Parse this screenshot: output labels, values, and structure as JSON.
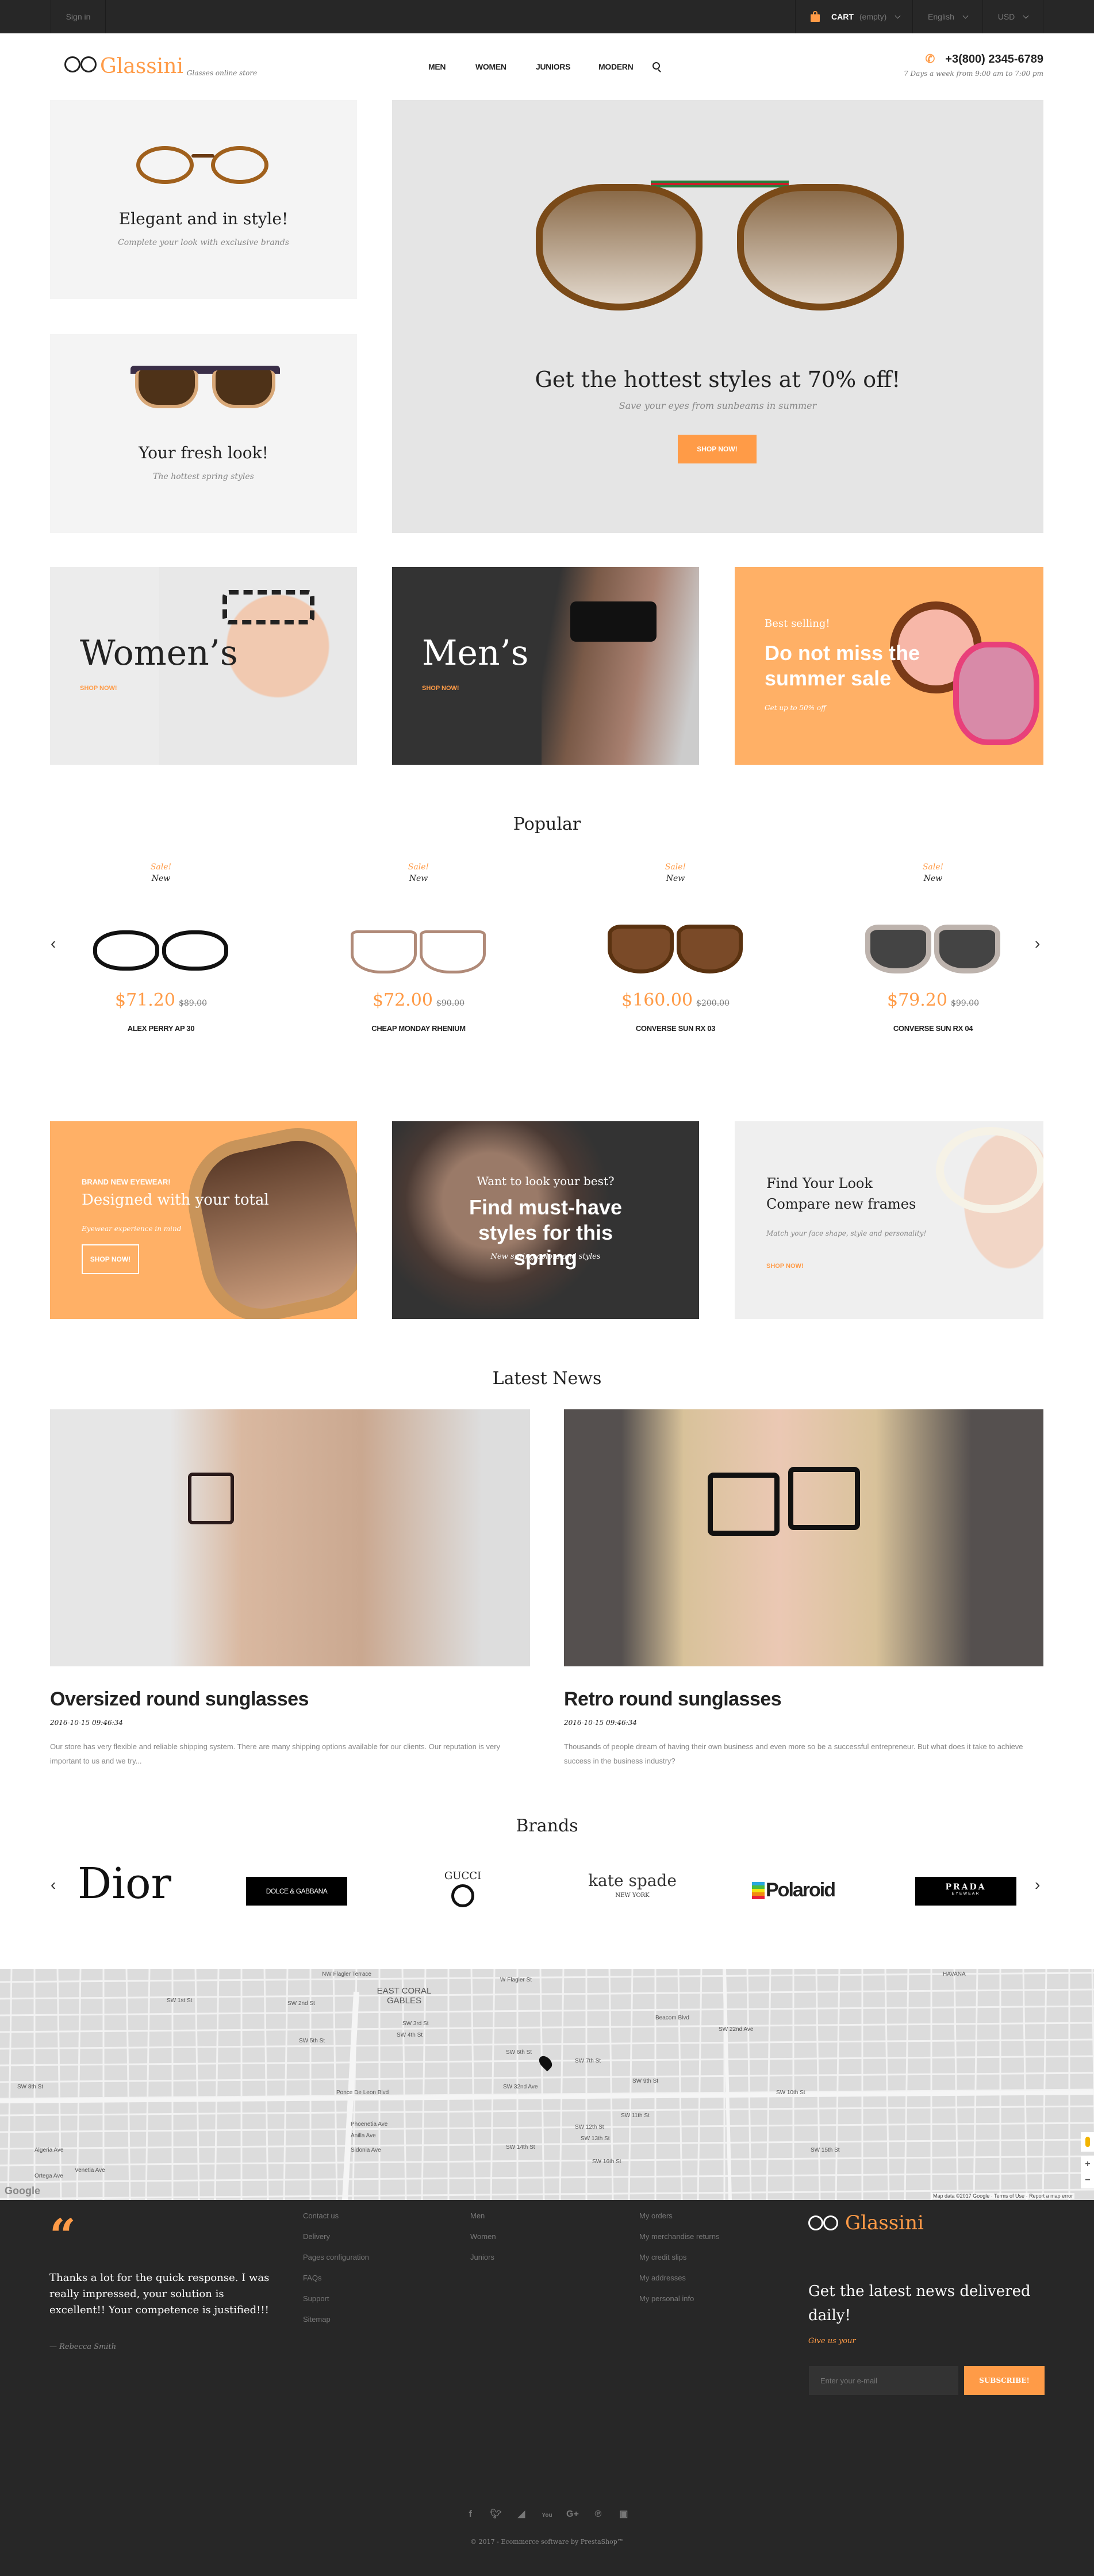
{
  "topbar": {
    "sign_in": "Sign in",
    "cart_label": "CART",
    "cart_status": "(empty)",
    "language": "English",
    "currency": "USD"
  },
  "header": {
    "logo_text": "Glassini",
    "tagline": "Glasses online store",
    "nav": [
      "MEN",
      "WOMEN",
      "JUNIORS",
      "MODERN"
    ],
    "phone": "+3(800) 2345-6789",
    "hours": "7 Days a week from 9:00 am to 7:00 pm"
  },
  "hero": {
    "left_top": {
      "title": "Elegant and in style!",
      "subtitle": "Complete your look with exclusive brands"
    },
    "left_bottom": {
      "title": "Your fresh look!",
      "subtitle": "The hottest spring styles"
    },
    "main": {
      "title": "Get the hottest styles at 70% off!",
      "subtitle": "Save your eyes from sunbeams in summer",
      "button": "SHOP NOW!"
    }
  },
  "categories": [
    {
      "title": "Women’s",
      "link": "SHOP NOW!"
    },
    {
      "title": "Men’s",
      "link": "SHOP NOW!"
    },
    {
      "kicker": "Best selling!",
      "title": "Do not miss the summer sale",
      "subtitle": "Get up to 50% off"
    }
  ],
  "popular": {
    "title": "Popular",
    "products": [
      {
        "sale": "Sale!",
        "badge": "New",
        "price": "$71.20",
        "old_price": "$89.00",
        "name": "ALEX PERRY AP 30"
      },
      {
        "sale": "Sale!",
        "badge": "New",
        "price": "$72.00",
        "old_price": "$90.00",
        "name": "CHEAP MONDAY RHENIUM"
      },
      {
        "sale": "Sale!",
        "badge": "New",
        "price": "$160.00",
        "old_price": "$200.00",
        "name": "CONVERSE SUN RX 03"
      },
      {
        "sale": "Sale!",
        "badge": "New",
        "price": "$79.20",
        "old_price": "$99.00",
        "name": "CONVERSE SUN RX 04"
      }
    ]
  },
  "promos": [
    {
      "kicker": "BRAND NEW EYEWEAR!",
      "title": "Designed with your total",
      "subtitle": "Eyewear experience in mind",
      "button": "SHOP NOW!"
    },
    {
      "kicker": "Want to look your best?",
      "title": "Find must-have styles for this spring",
      "subtitle": "New spring colors and styles"
    },
    {
      "title_line1": "Find Your Look",
      "title_line2": "Compare new frames",
      "subtitle": "Match your face shape, style and personality!",
      "link": "SHOP NOW!"
    }
  ],
  "news": {
    "title": "Latest News",
    "posts": [
      {
        "title": "Oversized round sunglasses",
        "date": "2016-10-15 09:46:34",
        "excerpt": "Our store has very flexible and reliable shipping system. There are many shipping options available for our clients. Our reputation is very important to us and we try..."
      },
      {
        "title": "Retro round sunglasses",
        "date": "2016-10-15 09:46:34",
        "excerpt": "Thousands of people dream of having their own business and even more so be a successful entrepreneur. But what does it take to achieve success in the business industry?"
      }
    ]
  },
  "brands": {
    "title": "Brands",
    "items": [
      "Dior",
      "DOLCE & GABBANA",
      "GUCCI",
      "kate spade",
      "Polaroid",
      "PRADA"
    ],
    "kate_sub": "NEW YORK",
    "prada_sub": "EYEWEAR"
  },
  "map": {
    "labels": [
      "EAST CORAL GABLES",
      "NW Flagler Terrace",
      "W Flagler St",
      "SW 1st St",
      "SW 2nd St",
      "SW 3rd St",
      "SW 4th St",
      "SW 5th St",
      "SW 6th St",
      "SW 7th St",
      "SW 8th St",
      "SW 9th St",
      "SW 10th St",
      "SW 11th St",
      "SW 12th St",
      "SW 13th St",
      "SW 14th St",
      "SW 15th St",
      "SW 16th St",
      "Ponce De Leon Blvd",
      "SW 32nd Ave",
      "SW 22nd Ave",
      "Beacom Blvd",
      "Phoenetia Ave",
      "Anilla Ave",
      "Sidonia Ave",
      "Algeria Ave",
      "Ortega Ave",
      "Venetia Ave",
      "HAVANA"
    ],
    "attribution": "Map data ©2017 Google",
    "terms": "Terms of Use",
    "report": "Report a map error",
    "google": "Google",
    "zoom_in": "+",
    "zoom_out": "−"
  },
  "footer": {
    "testimonial": "Thanks a lot for the quick response. I was really impressed, your solution is excellent!! Your competence is justified!!!",
    "author": "— Rebecca Smith",
    "col1": [
      "Contact us",
      "Delivery",
      "Pages configuration",
      "FAQs",
      "Support",
      "Sitemap"
    ],
    "col2": [
      "Men",
      "Women",
      "Juniors"
    ],
    "col3": [
      "My orders",
      "My merchandise returns",
      "My credit slips",
      "My addresses",
      "My personal info"
    ],
    "logo_text": "Glassini",
    "newsletter_title": "Get the latest news delivered daily!",
    "newsletter_sub": "Give us your",
    "email_placeholder": "Enter your e-mail",
    "subscribe": "SUBSCRIBE!",
    "social": [
      "f",
      "t",
      "rss",
      "You",
      "G+",
      "P",
      "ig"
    ],
    "copyright": "© 2017 - Ecommerce software by PrestaShop™"
  },
  "colors": {
    "accent": "#ff9b47",
    "dark": "#272727",
    "panel": "#f4f4f4"
  }
}
